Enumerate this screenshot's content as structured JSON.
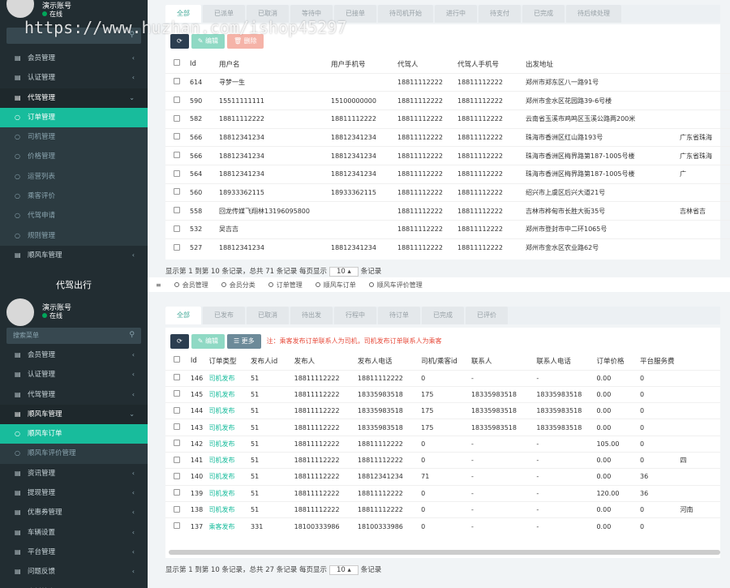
{
  "top": {
    "sidebar": {
      "username": "演示账号",
      "status": "在线",
      "menu": [
        {
          "label": "会员管理",
          "type": "item"
        },
        {
          "label": "认证管理",
          "type": "item"
        },
        {
          "label": "代驾管理",
          "type": "open"
        },
        {
          "label": "订单管理",
          "type": "subactive"
        },
        {
          "label": "司机管理",
          "type": "sub"
        },
        {
          "label": "价格管理",
          "type": "sub"
        },
        {
          "label": "运营列表",
          "type": "sub"
        },
        {
          "label": "乘客评价",
          "type": "sub"
        },
        {
          "label": "代驾申请",
          "type": "sub"
        },
        {
          "label": "规则管理",
          "type": "sub"
        },
        {
          "label": "顺风车管理",
          "type": "item"
        }
      ]
    },
    "tabs": [
      "全部",
      "已派单",
      "已取消",
      "等待中",
      "已接单",
      "待司机开始",
      "进行中",
      "待支付",
      "已完成",
      "待后续处理"
    ],
    "buttons": {
      "refresh": "⟳",
      "edit": "编辑",
      "delete": "删除"
    },
    "columns": [
      "Id",
      "用户名",
      "用户手机号",
      "代驾人",
      "代驾人手机号",
      "出发地址",
      ""
    ],
    "rows": [
      [
        "614",
        "寻梦一生",
        "",
        "18811112222",
        "18811112222",
        "郑州市郑东区八一路91号",
        ""
      ],
      [
        "590",
        "15511111111",
        "15100000000",
        "18811112222",
        "18811112222",
        "郑州市金水区花园路39-6号楼",
        ""
      ],
      [
        "582",
        "18811112222",
        "18811112222",
        "18811112222",
        "18811112222",
        "云南省玉溪市鸡鸣区玉溪公路两200米",
        ""
      ],
      [
        "566",
        "18812341234",
        "18812341234",
        "18811112222",
        "18811112222",
        "珠海市香洲区红山路193号",
        "广东省珠海"
      ],
      [
        "566",
        "18812341234",
        "18812341234",
        "18811112222",
        "18811112222",
        "珠海市香洲区梅界路第187-1005号楼",
        "广东省珠海"
      ],
      [
        "564",
        "18812341234",
        "18812341234",
        "18811112222",
        "18811112222",
        "珠海市香洲区梅界路第187-1005号楼",
        "广"
      ],
      [
        "560",
        "18933362115",
        "18933362115",
        "18811112222",
        "18811112222",
        "绍兴市上虞区后兴大道21号",
        ""
      ],
      [
        "558",
        "回龙传媒飞翔林13196095800",
        "",
        "18811112222",
        "18811112222",
        "吉林市桦甸市长胜大街35号",
        "吉林省吉"
      ],
      [
        "532",
        "吴吉吉",
        "",
        "18811112222",
        "18811112222",
        "郑州市登封市中二环1065号",
        ""
      ],
      [
        "527",
        "18812341234",
        "18812341234",
        "18811112222",
        "18811112222",
        "郑州市金水区农业路62号",
        ""
      ]
    ],
    "footer": {
      "text": "显示第 1 到第 10 条记录，总共 71 条记录 每页显示",
      "per_page": "10 ▴",
      "suffix": "条记录"
    }
  },
  "bottom": {
    "brand": "代驾出行",
    "topnav": [
      "会员管理",
      "会员分类",
      "订单管理",
      "顺风车订单",
      "顺风车评价管理"
    ],
    "sidebar": {
      "username": "演示账号",
      "status": "在线",
      "search_placeholder": "搜索菜单",
      "menu": [
        {
          "label": "会员管理",
          "type": "item"
        },
        {
          "label": "认证管理",
          "type": "item"
        },
        {
          "label": "代驾管理",
          "type": "item"
        },
        {
          "label": "顺风车管理",
          "type": "open"
        },
        {
          "label": "顺风车订单",
          "type": "subactive"
        },
        {
          "label": "顺风车评价管理",
          "type": "sub"
        },
        {
          "label": "资讯管理",
          "type": "item"
        },
        {
          "label": "提现管理",
          "type": "item"
        },
        {
          "label": "优惠券管理",
          "type": "item"
        },
        {
          "label": "车辆设置",
          "type": "item"
        },
        {
          "label": "平台管理",
          "type": "item"
        },
        {
          "label": "问题反馈",
          "type": "item"
        },
        {
          "label": "资料档案",
          "type": "item"
        }
      ]
    },
    "tabs": [
      "全部",
      "已发布",
      "已取消",
      "待出发",
      "行程中",
      "待订单",
      "已完成",
      "已评价"
    ],
    "buttons": {
      "refresh": "⟳",
      "edit": "编辑",
      "more": "更多"
    },
    "notice": "注：乘客发布订单联系人为司机，司机发布订单联系人为乘客",
    "columns": [
      "Id",
      "订单类型",
      "发布人id",
      "发布人",
      "发布人电话",
      "司机/乘客id",
      "联系人",
      "联系人电话",
      "订单价格",
      "平台服务费",
      ""
    ],
    "rows": [
      [
        "146",
        "司机发布",
        "51",
        "18811112222",
        "18811112222",
        "0",
        "-",
        "-",
        "0.00",
        "0",
        ""
      ],
      [
        "145",
        "司机发布",
        "51",
        "18811112222",
        "18335983518",
        "175",
        "18335983518",
        "18335983518",
        "0.00",
        "0",
        ""
      ],
      [
        "144",
        "司机发布",
        "51",
        "18811112222",
        "18335983518",
        "175",
        "18335983518",
        "18335983518",
        "0.00",
        "0",
        ""
      ],
      [
        "143",
        "司机发布",
        "51",
        "18811112222",
        "18335983518",
        "175",
        "18335983518",
        "18335983518",
        "0.00",
        "0",
        ""
      ],
      [
        "142",
        "司机发布",
        "51",
        "18811112222",
        "18811112222",
        "0",
        "-",
        "-",
        "105.00",
        "0",
        ""
      ],
      [
        "141",
        "司机发布",
        "51",
        "18811112222",
        "18811112222",
        "0",
        "-",
        "-",
        "0.00",
        "0",
        "四"
      ],
      [
        "140",
        "司机发布",
        "51",
        "18811112222",
        "18812341234",
        "71",
        "-",
        "-",
        "0.00",
        "36",
        ""
      ],
      [
        "139",
        "司机发布",
        "51",
        "18811112222",
        "18811112222",
        "0",
        "-",
        "-",
        "120.00",
        "36",
        ""
      ],
      [
        "138",
        "司机发布",
        "51",
        "18811112222",
        "18811112222",
        "0",
        "-",
        "-",
        "0.00",
        "0",
        "河南"
      ],
      [
        "137",
        "乘客发布",
        "331",
        "18100333986",
        "18100333986",
        "0",
        "-",
        "-",
        "0.00",
        "0",
        ""
      ]
    ],
    "footer": {
      "text": "显示第 1 到第 10 条记录，总共 27 条记录 每页显示",
      "per_page": "10 ▴",
      "suffix": "条记录"
    }
  },
  "watermark": "https://www.huzhan.com/ishop45297",
  "colors": {
    "sidebar": "#222d32",
    "accent": "#18bc9c",
    "danger": "#e74c3c"
  }
}
